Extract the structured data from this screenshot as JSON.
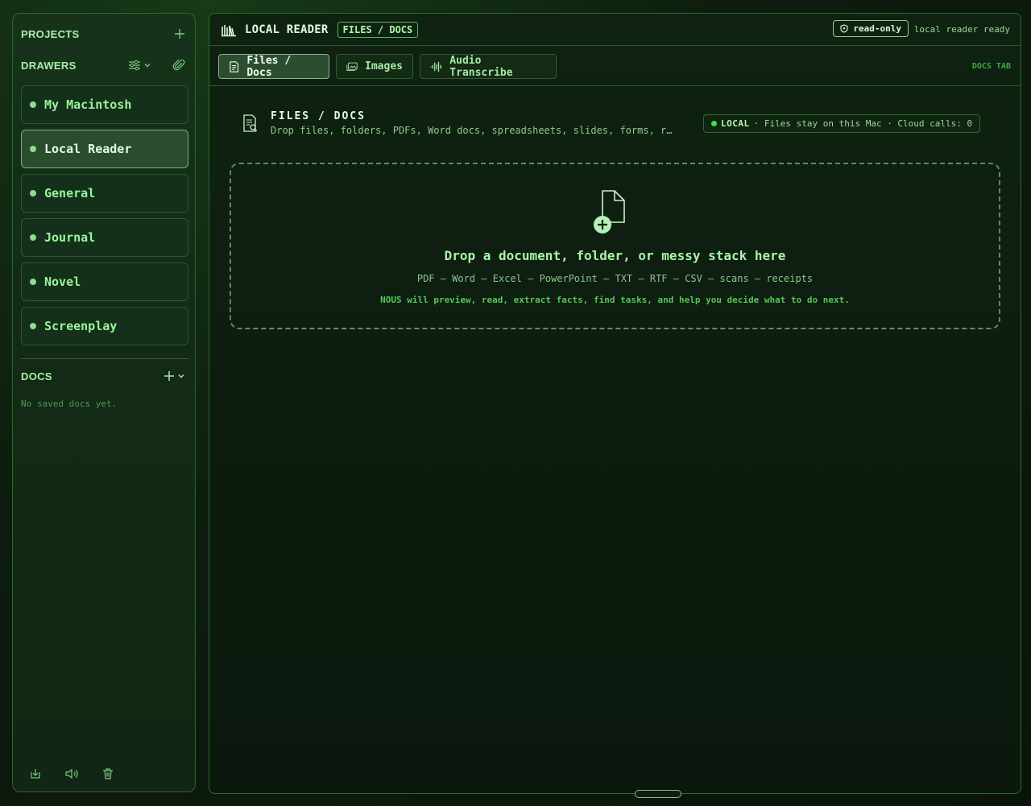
{
  "sidebar": {
    "projects_title": "PROJECTS",
    "drawers_title": "DRAWERS",
    "docs_title": "DOCS",
    "no_docs": "No saved docs yet.",
    "drawers": [
      {
        "label": "My Macintosh",
        "active": false
      },
      {
        "label": "Local Reader",
        "active": true
      },
      {
        "label": "General",
        "active": false
      },
      {
        "label": "Journal",
        "active": false
      },
      {
        "label": "Novel",
        "active": false
      },
      {
        "label": "Screenplay",
        "active": false
      }
    ]
  },
  "header": {
    "app_title": "LOCAL READER",
    "crumb": "FILES / DOCS",
    "readonly": "read-only",
    "status": "local reader ready"
  },
  "tabs": [
    {
      "label": "Files / Docs",
      "active": true,
      "icon": "document-icon"
    },
    {
      "label": "Images",
      "active": false,
      "icon": "images-icon"
    },
    {
      "label": "Audio Transcribe",
      "active": false,
      "icon": "waveform-icon"
    }
  ],
  "tab_context": "DOCS TAB",
  "section": {
    "title": "FILES / DOCS",
    "subtitle": "Drop files, folders, PDFs, Word docs, spreadsheets, slides, forms, re…"
  },
  "local_badge": {
    "name": "LOCAL",
    "text": "· Files stay on this Mac · Cloud calls: 0"
  },
  "dropzone": {
    "title": "Drop a document, folder, or messy stack here",
    "formats": "PDF – Word – Excel – PowerPoint – TXT – RTF – CSV – scans – receipts",
    "help": "NOUS will preview, read, extract facts, find tasks, and help you decide what to do next."
  },
  "colors": {
    "accent": "#9bf59b",
    "border": "#2a6a2c",
    "background": "#0b160c",
    "local_dot": "#39e04a"
  }
}
